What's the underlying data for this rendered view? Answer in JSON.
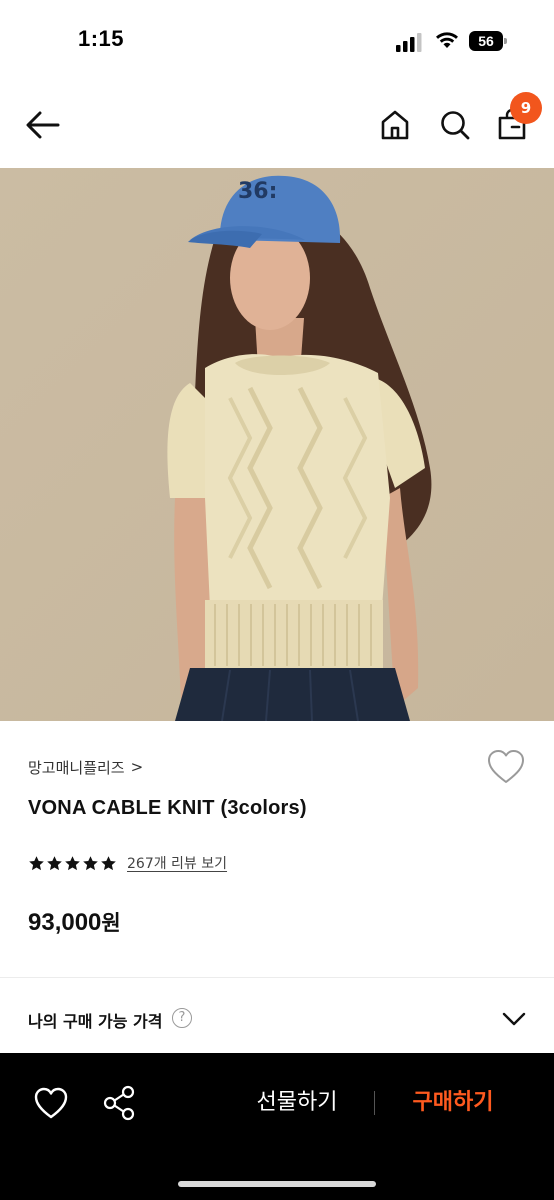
{
  "status_bar": {
    "time": "1:15",
    "battery": "56"
  },
  "header": {
    "icons": [
      "back-arrow-icon",
      "home-icon",
      "search-icon",
      "shopping-bag-icon"
    ],
    "cart_count": "9",
    "accent_color": "#f2561d"
  },
  "hero_image": {
    "cap_text": "36:"
  },
  "product": {
    "brand": "망고매니플리즈",
    "brand_chevron": ">",
    "title": "VONA CABLE KNIT (3colors)",
    "rating_stars": 5,
    "review_link": "267개 리뷰 보기",
    "price_number": "93,000",
    "price_unit": "원"
  },
  "my_price": {
    "label": "나의 구매 가능 가격",
    "help": "?"
  },
  "bottom_bar": {
    "icons": [
      "heart-icon",
      "share-icon"
    ],
    "gift_label": "선물하기",
    "buy_label": "구매하기",
    "buy_color": "#ff5a1f"
  }
}
